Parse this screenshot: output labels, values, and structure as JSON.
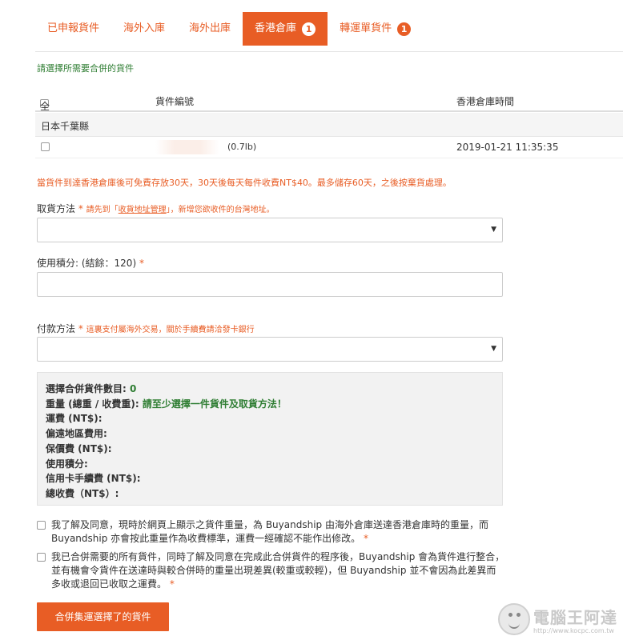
{
  "tabs": [
    {
      "label": "已申報貨件"
    },
    {
      "label": "海外入庫"
    },
    {
      "label": "海外出庫"
    },
    {
      "label": "香港倉庫",
      "badge": "1",
      "active": true
    },
    {
      "label": "轉運單貨件",
      "badge": "1"
    }
  ],
  "instruction": "請選擇所需要合併的貨件",
  "table": {
    "select_all": "全選",
    "col_number": "貨件編號",
    "col_time": "香港倉庫時間",
    "group": "日本千葉縣",
    "rows": [
      {
        "weight": "(0.7lb)",
        "time": "2019-01-21 11:35:35"
      }
    ]
  },
  "notice": "當貨件到達香港倉庫後可免費存放30天，30天後每天每件收費NT$40。最多儲存60天，之後按棄貨處理。",
  "pickup": {
    "label": "取貨方法",
    "req": "*",
    "hint_pre": "請先到「",
    "hint_link": "收貨地址管理",
    "hint_post": "」，新增您欲收件的台灣地址。",
    "value": ""
  },
  "points": {
    "label": "使用積分: (結餘：120)",
    "req": "*",
    "value": ""
  },
  "payment": {
    "label": "付款方法",
    "req": "*",
    "hint": "這裏支付屬海外交易，關於手續費請洽發卡銀行",
    "value": ""
  },
  "summary": {
    "count_label": "選擇合併貨件數目: ",
    "count_value": "0",
    "weight_label": "重量 (總重 / 收費重): ",
    "weight_value": "請至少選擇一件貨件及取貨方法！",
    "shipping": "運費 (NT$):",
    "remote": "偏遠地區費用:",
    "insurance": "保價費 (NT$):",
    "points_used": "使用積分:",
    "card_fee": "信用卡手續費 (NT$):",
    "total": "總收費（NT$）:"
  },
  "agree1": {
    "text": "我了解及同意，現時於網頁上顯示之貨件重量，為 Buyandship 由海外倉庫送達香港倉庫時的重量，而 Buyandship 亦會按此重量作為收費標準，運費一經確認不能作出修改。",
    "star": "*"
  },
  "agree2": {
    "text": "我已合併需要的所有貨件，同時了解及同意在完成此合併貨件的程序後，Buyandship 會為貨件進行整合，並有機會令貨件在送達時與較合併時的重量出現差異(較重或較輕)，但 Buyandship 並不會因為此差異而多收或退回已收取之運費。",
    "star": "*"
  },
  "submit_label": "合併集運選擇了的貨件",
  "watermark": {
    "text": "電腦王阿達",
    "url": "http://www.kocpc.com.tw"
  },
  "colors": {
    "accent": "#e85d25",
    "green": "#2e7d32"
  }
}
